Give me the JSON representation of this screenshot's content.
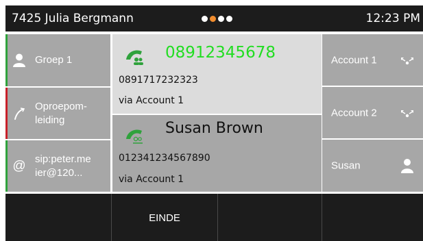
{
  "status_bar": {
    "user": "7425 Julia Bergmann",
    "time": "12:23 PM",
    "page_indicator": {
      "count": 4,
      "active_index": 1
    }
  },
  "left_keys": [
    {
      "label_lines": [
        "Groep 1"
      ],
      "icon": "person-icon",
      "indicator": "#2fa23c"
    },
    {
      "label_lines": [
        "Oproepom-",
        "leiding"
      ],
      "icon": "call-forward-icon",
      "indicator": "#c8202a"
    },
    {
      "label_lines": [
        "sip:peter.me",
        "ier@120..."
      ],
      "icon": "at-icon",
      "indicator": "#2fa23c"
    }
  ],
  "calls": [
    {
      "name": "08912345678",
      "number": "0891717232323",
      "via": "via Account 1",
      "icon": "active-call-icon",
      "name_color": "#22dd22"
    },
    {
      "name": "Susan Brown",
      "number": "012341234567890",
      "via": "via Account 1",
      "icon": "held-call-icon",
      "name_color": "#111111"
    }
  ],
  "right_keys": [
    {
      "label": "Account 1",
      "icon": "conference-icon"
    },
    {
      "label": "Account 2",
      "icon": "conference-icon"
    },
    {
      "label": "Susan",
      "icon": "person-icon"
    }
  ],
  "softkeys": [
    "",
    "EINDE",
    "",
    ""
  ],
  "colors": {
    "accent_green": "#2fa23c",
    "accent_red": "#c8202a",
    "page_dot_active": "#f08c2e"
  }
}
